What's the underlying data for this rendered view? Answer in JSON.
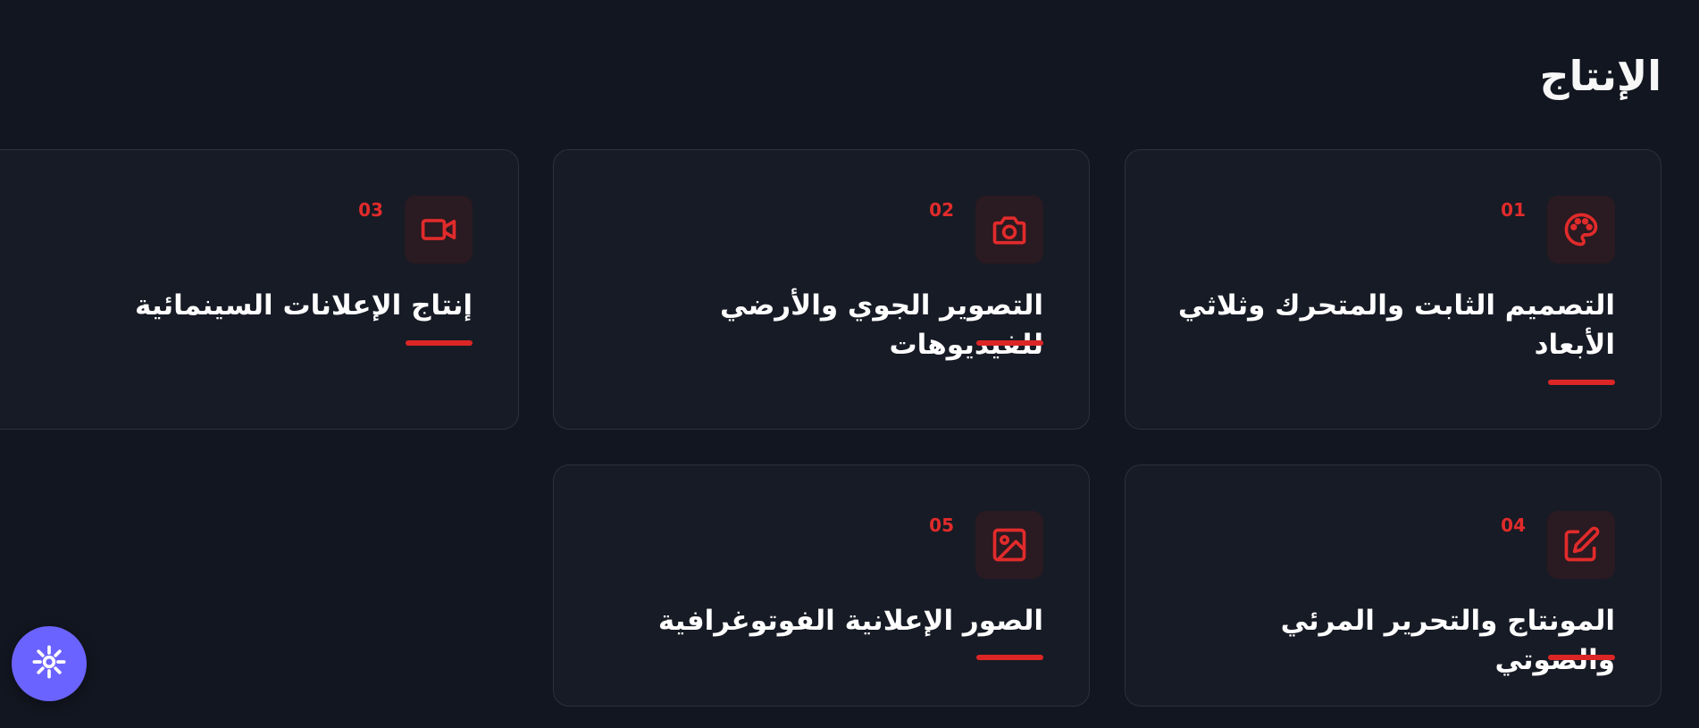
{
  "top_text": "",
  "section": {
    "title": "الإنتاج"
  },
  "cards": [
    {
      "number": "01",
      "title": "التصميم الثابت والمتحرك وثلاثي الأبعاد",
      "icon": "palette-icon"
    },
    {
      "number": "02",
      "title": "التصوير الجوي والأرضي للفيديوهات",
      "icon": "camera-icon"
    },
    {
      "number": "03",
      "title": "إنتاج الإعلانات السينمائية",
      "icon": "video-camera-icon"
    },
    {
      "number": "04",
      "title": "المونتاج والتحرير المرئي والصوتي",
      "icon": "edit-icon"
    },
    {
      "number": "05",
      "title": "الصور الإعلانية الفوتوغرافية",
      "icon": "image-icon"
    }
  ],
  "colors": {
    "background": "#121620",
    "card": "#171b25",
    "accent": "#dc2626",
    "floating_button": "#6b63ff"
  },
  "floating_button": {
    "icon": "accessibility-icon"
  }
}
